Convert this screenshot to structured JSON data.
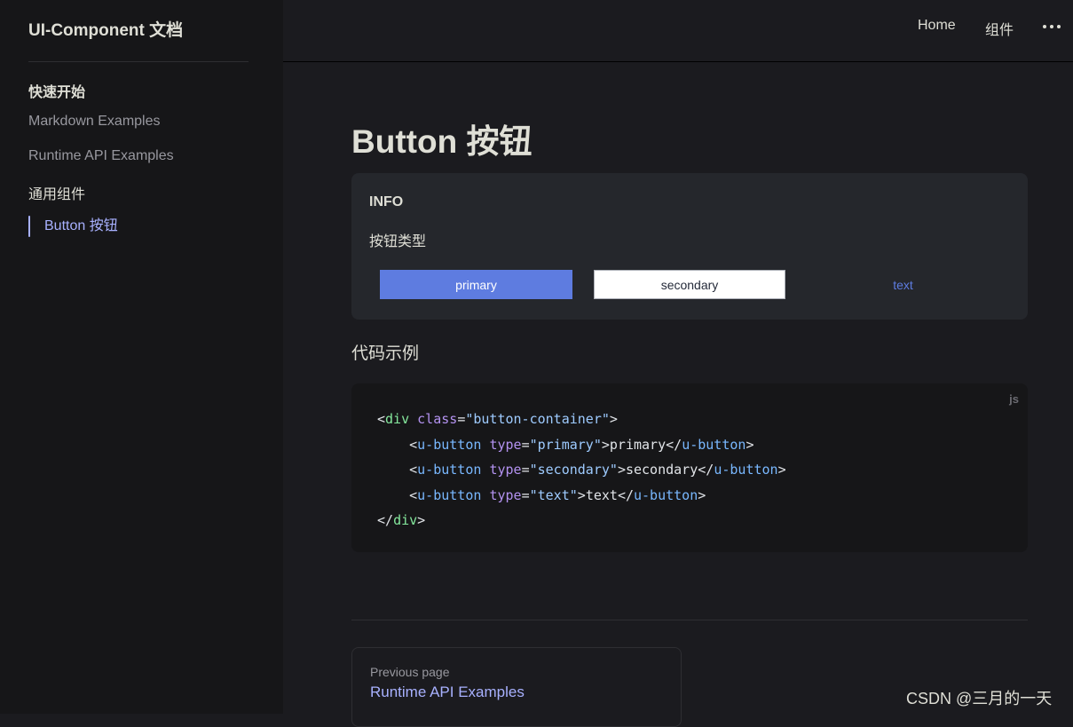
{
  "sidebar": {
    "site_title": "UI-Component 文档",
    "items": [
      {
        "label": "快速开始"
      },
      {
        "label": "Markdown Examples"
      },
      {
        "label": "Runtime API Examples"
      },
      {
        "label": "通用组件"
      },
      {
        "label": "Button 按钮"
      }
    ]
  },
  "nav": {
    "home": "Home",
    "components": "组件",
    "more_icon": "more-horizontal-icon"
  },
  "main": {
    "title": "Button 按钮",
    "info": {
      "label": "INFO",
      "text": "按钮类型",
      "buttons": {
        "primary": "primary",
        "secondary": "secondary",
        "text": "text"
      }
    },
    "section_heading": "代码示例",
    "code": {
      "lang": "js",
      "lines": [
        "<div class=\"button-container\">",
        "    <u-button type=\"primary\">primary</u-button>",
        "    <u-button type=\"secondary\">secondary</u-button>",
        "    <u-button type=\"text\">text</u-button>",
        "</div>"
      ]
    },
    "prev": {
      "label": "Previous page",
      "title": "Runtime API Examples"
    }
  },
  "watermark": "CSDN @三月的一天",
  "colors": {
    "accent": "#a8b1ff",
    "primary_button": "#5e7ce0",
    "background": "#1b1b1f",
    "sidebar": "#161618"
  }
}
